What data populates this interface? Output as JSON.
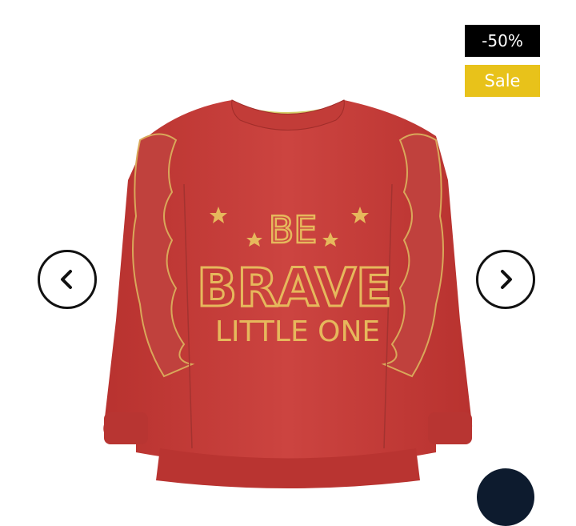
{
  "badges": {
    "discount": "-50%",
    "sale": "Sale"
  },
  "colors": {
    "sale_badge": "#e8c21a",
    "discount_badge": "#000000",
    "sweater": "#c73f3a",
    "print": "#e6b85c"
  },
  "product": {
    "image_alt": "Red sweatshirt with ruffled shoulders",
    "print_lines": [
      "BE",
      "BRAVE",
      "LITTLE ONE"
    ]
  },
  "carousel": {
    "prev_icon": "chevron-left-icon",
    "next_icon": "chevron-right-icon"
  }
}
